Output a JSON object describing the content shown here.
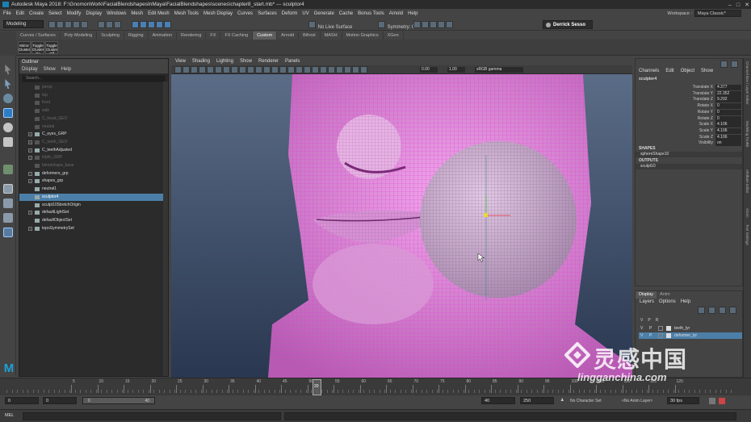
{
  "window": {
    "title": "Autodesk Maya 2018: F:\\GnomonWork\\FacialBlendshapesInMaya\\FacialBlendshapes\\scenes\\chapter8_start.mb*  ---  sculptor4",
    "min": "–",
    "max": "□",
    "close": "✕"
  },
  "menubar": [
    "File",
    "Edit",
    "Create",
    "Select",
    "Modify",
    "Display",
    "Windows",
    "Mesh",
    "Edit Mesh",
    "Mesh Tools",
    "Mesh Display",
    "Curves",
    "Surfaces",
    "Deform",
    "UV",
    "Generate",
    "Cache",
    "Bonus Tools",
    "Arnold",
    "Help"
  ],
  "workspace": {
    "label": "Workspace :",
    "value": "Maya Classic*"
  },
  "statusline": {
    "mode": "Modeling",
    "live_surface": "No Live Surface",
    "symmetry": "Symmetry: Off",
    "user": "Derrick Sesso"
  },
  "shelf_tabs": [
    "Curves / Surfaces",
    "Poly Modeling",
    "Sculpting",
    "Rigging",
    "Animation",
    "Rendering",
    "FX",
    "FX Caching",
    "Custom",
    "Arnold",
    "Bifrost",
    "MASH",
    "Motion Graphics",
    "XGen"
  ],
  "shelf_active": "Custom",
  "shelf_buttons": [
    {
      "label": "Mirror Cluster"
    },
    {
      "label": "Toggle Cluster On"
    },
    {
      "label": "Toggle Cluster Off"
    }
  ],
  "outliner": {
    "title": "Outliner",
    "menu": [
      "Display",
      "Show",
      "Help"
    ],
    "search_placeholder": "Search...",
    "rows": [
      {
        "label": "persp",
        "dim": true,
        "expand": false
      },
      {
        "label": "top",
        "dim": true,
        "expand": false
      },
      {
        "label": "front",
        "dim": true,
        "expand": false
      },
      {
        "label": "side",
        "dim": true,
        "expand": false
      },
      {
        "label": "C_head_GEO",
        "dim": true,
        "expand": false
      },
      {
        "label": "neutral",
        "dim": true,
        "expand": false
      },
      {
        "label": "C_eyes_GRP",
        "dim": false,
        "expand": true
      },
      {
        "label": "C_teeth_GEO",
        "dim": true,
        "expand": true
      },
      {
        "label": "C_teethAdjusted",
        "dim": false,
        "expand": true
      },
      {
        "label": "triplic_GRP",
        "dim": true,
        "expand": true
      },
      {
        "label": "blendshape_base",
        "dim": true,
        "expand": false
      },
      {
        "label": "deformers_grp",
        "dim": false,
        "expand": true
      },
      {
        "label": "shapes_grp",
        "dim": false,
        "expand": true
      },
      {
        "label": "neutral1",
        "dim": false,
        "expand": false
      },
      {
        "label": "sculptor4",
        "dim": false,
        "expand": false,
        "selected": true
      },
      {
        "label": "sculpt10StretchOrigin",
        "dim": false,
        "expand": false
      },
      {
        "label": "defaultLightSet",
        "dim": false,
        "expand": true
      },
      {
        "label": "defaultObjectSet",
        "dim": false,
        "expand": false
      },
      {
        "label": "topoSymmetrySet",
        "dim": false,
        "expand": true
      }
    ]
  },
  "viewport": {
    "menu": [
      "View",
      "Shading",
      "Lighting",
      "Show",
      "Renderer",
      "Panels"
    ],
    "exposure": "0.00",
    "gamma": "1.00",
    "colorspace": "sRGB gamma"
  },
  "channel_box": {
    "menu": [
      "Channels",
      "Edit",
      "Object",
      "Show"
    ],
    "node": "sculptor4",
    "attributes": [
      {
        "name": "Translate X",
        "value": "4.377"
      },
      {
        "name": "Translate Y",
        "value": "22.352"
      },
      {
        "name": "Translate Z",
        "value": "9.292"
      },
      {
        "name": "Rotate X",
        "value": "0"
      },
      {
        "name": "Rotate Y",
        "value": "0"
      },
      {
        "name": "Rotate Z",
        "value": "0"
      },
      {
        "name": "Scale X",
        "value": "4.106"
      },
      {
        "name": "Scale Y",
        "value": "4.106"
      },
      {
        "name": "Scale Z",
        "value": "4.106"
      },
      {
        "name": "Visibility",
        "value": "on"
      }
    ],
    "shapes_label": "SHAPES",
    "shape": "sphereShape10",
    "outputs_label": "OUTPUTS",
    "output": "sculpt10"
  },
  "layers": {
    "tabs": [
      "Display",
      "Anim"
    ],
    "menu": [
      "Layers",
      "Options",
      "Help"
    ],
    "header": [
      "V",
      "P",
      "R"
    ],
    "rows": [
      {
        "v": "V",
        "p": "P",
        "r": "",
        "name": "teeth_lyr",
        "selected": false
      },
      {
        "v": "V",
        "p": "P",
        "r": "",
        "name": "deformer_lyr",
        "selected": true
      }
    ]
  },
  "right_tabs": [
    "Channel Box / Layer Editor",
    "Modeling Toolkit",
    "Attribute Editor",
    "XGen",
    "Tool Settings"
  ],
  "maya_logo": "M",
  "timeline": {
    "ticks": [
      "5",
      "10",
      "15",
      "20",
      "25",
      "30",
      "35",
      "40",
      "45",
      "50",
      "55",
      "60",
      "65",
      "70",
      "75",
      "80",
      "85",
      "90",
      "95",
      "100",
      "105",
      "110",
      "115",
      "120"
    ],
    "current": "20"
  },
  "range": {
    "start": "0",
    "anim_start": "0",
    "slider_left": "0",
    "slider_right": "40",
    "end": "40",
    "anim_end": "250",
    "character_set": "No Character Set",
    "anim_layer": "<No Anim Layer>",
    "fps": "30 fps"
  },
  "command_line": {
    "label": "MEL"
  },
  "watermark": {
    "cn": "灵感中国",
    "en": "lingganchina.com"
  }
}
